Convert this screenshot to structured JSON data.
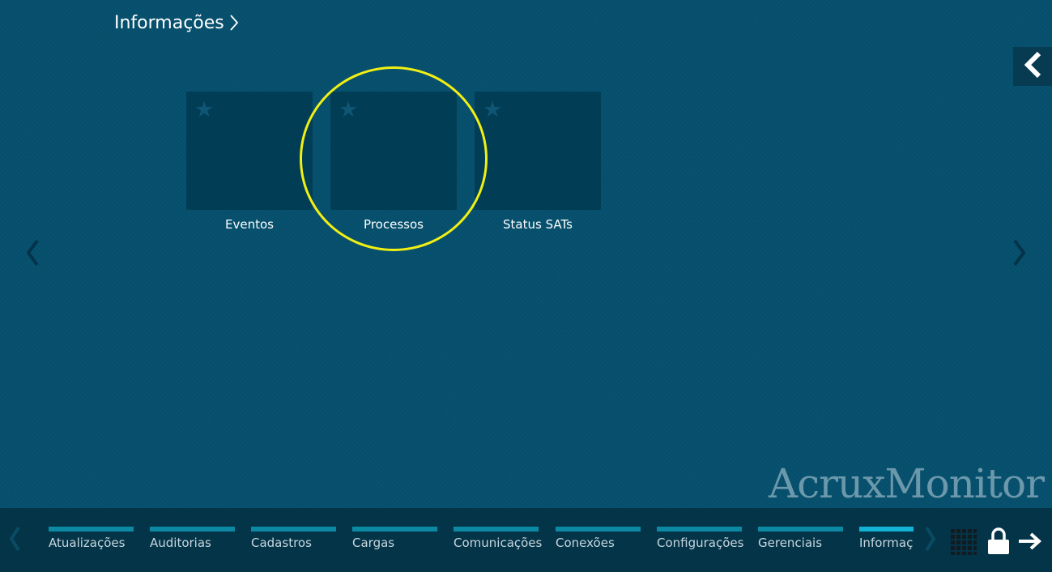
{
  "header": {
    "title": "Informações",
    "title_icon": "chevron-right-icon"
  },
  "back_button": {
    "icon": "chevron-left-icon"
  },
  "tiles": [
    {
      "label": "Eventos",
      "icon": "star-icon"
    },
    {
      "label": "Processos",
      "icon": "star-icon"
    },
    {
      "label": "Status SATs",
      "icon": "star-icon"
    }
  ],
  "highlight": {
    "target": "Processos",
    "color": "#f1ef14"
  },
  "brand": {
    "text": "AcruxMonitor"
  },
  "bottom_bar": {
    "categories": [
      {
        "label": "Atualizações",
        "active": false
      },
      {
        "label": "Auditorias",
        "active": false
      },
      {
        "label": "Cadastros",
        "active": false
      },
      {
        "label": "Cargas",
        "active": false
      },
      {
        "label": "Comunicações",
        "active": false
      },
      {
        "label": "Conexões",
        "active": false
      },
      {
        "label": "Configurações",
        "active": false
      },
      {
        "label": "Gerenciais",
        "active": false
      },
      {
        "label": "Informações",
        "active": true
      }
    ],
    "icons": [
      "grid-icon",
      "lock-icon",
      "logout-arrow-icon"
    ]
  },
  "colors": {
    "background": "#06506d",
    "tile": "#013e56",
    "bottom_bar": "#043448",
    "category_bar": "#0d8aa3",
    "category_bar_active": "#12b3d6",
    "brand": "#6c98ab"
  }
}
